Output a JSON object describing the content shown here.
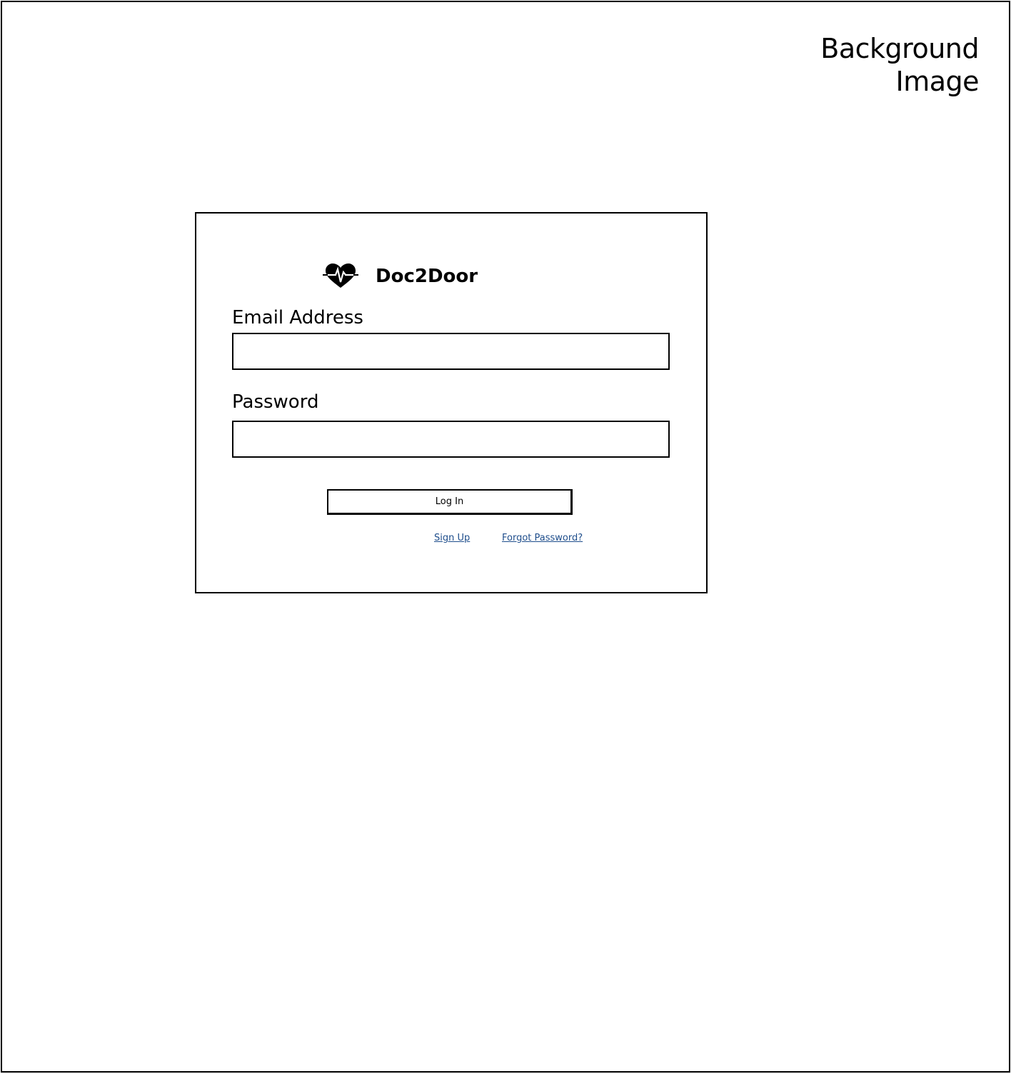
{
  "background": {
    "caption": "Background Image"
  },
  "login": {
    "brand": {
      "name": "Doc2Door",
      "icon": "heart-pulse-icon"
    },
    "email": {
      "label": "Email Address",
      "value": "",
      "placeholder": ""
    },
    "password": {
      "label": "Password",
      "value": "",
      "placeholder": ""
    },
    "login_button_label": "Log In",
    "signup_link": "Sign Up",
    "forgot_link": "Forgot Password?"
  },
  "colors": {
    "link": "#1f4e8c",
    "border": "#000000"
  }
}
